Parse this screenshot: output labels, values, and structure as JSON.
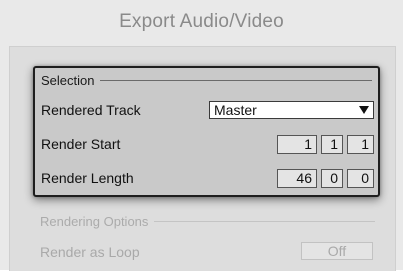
{
  "dialog": {
    "title": "Export Audio/Video"
  },
  "selection": {
    "heading": "Selection",
    "rendered_track": {
      "label": "Rendered Track",
      "value": "Master"
    },
    "render_start": {
      "label": "Render Start",
      "bars": "1",
      "beats": "1",
      "sixteenths": "1"
    },
    "render_length": {
      "label": "Render Length",
      "bars": "46",
      "beats": "0",
      "sixteenths": "0"
    }
  },
  "rendering_options": {
    "heading": "Rendering Options",
    "render_as_loop": {
      "label": "Render as Loop",
      "value": "Off"
    }
  },
  "colors": {
    "dialog_background": "#e9e9e9",
    "panel_background": "#dddddd",
    "selection_background": "#c9c9c9",
    "disabled_text": "#a9a9a9"
  }
}
